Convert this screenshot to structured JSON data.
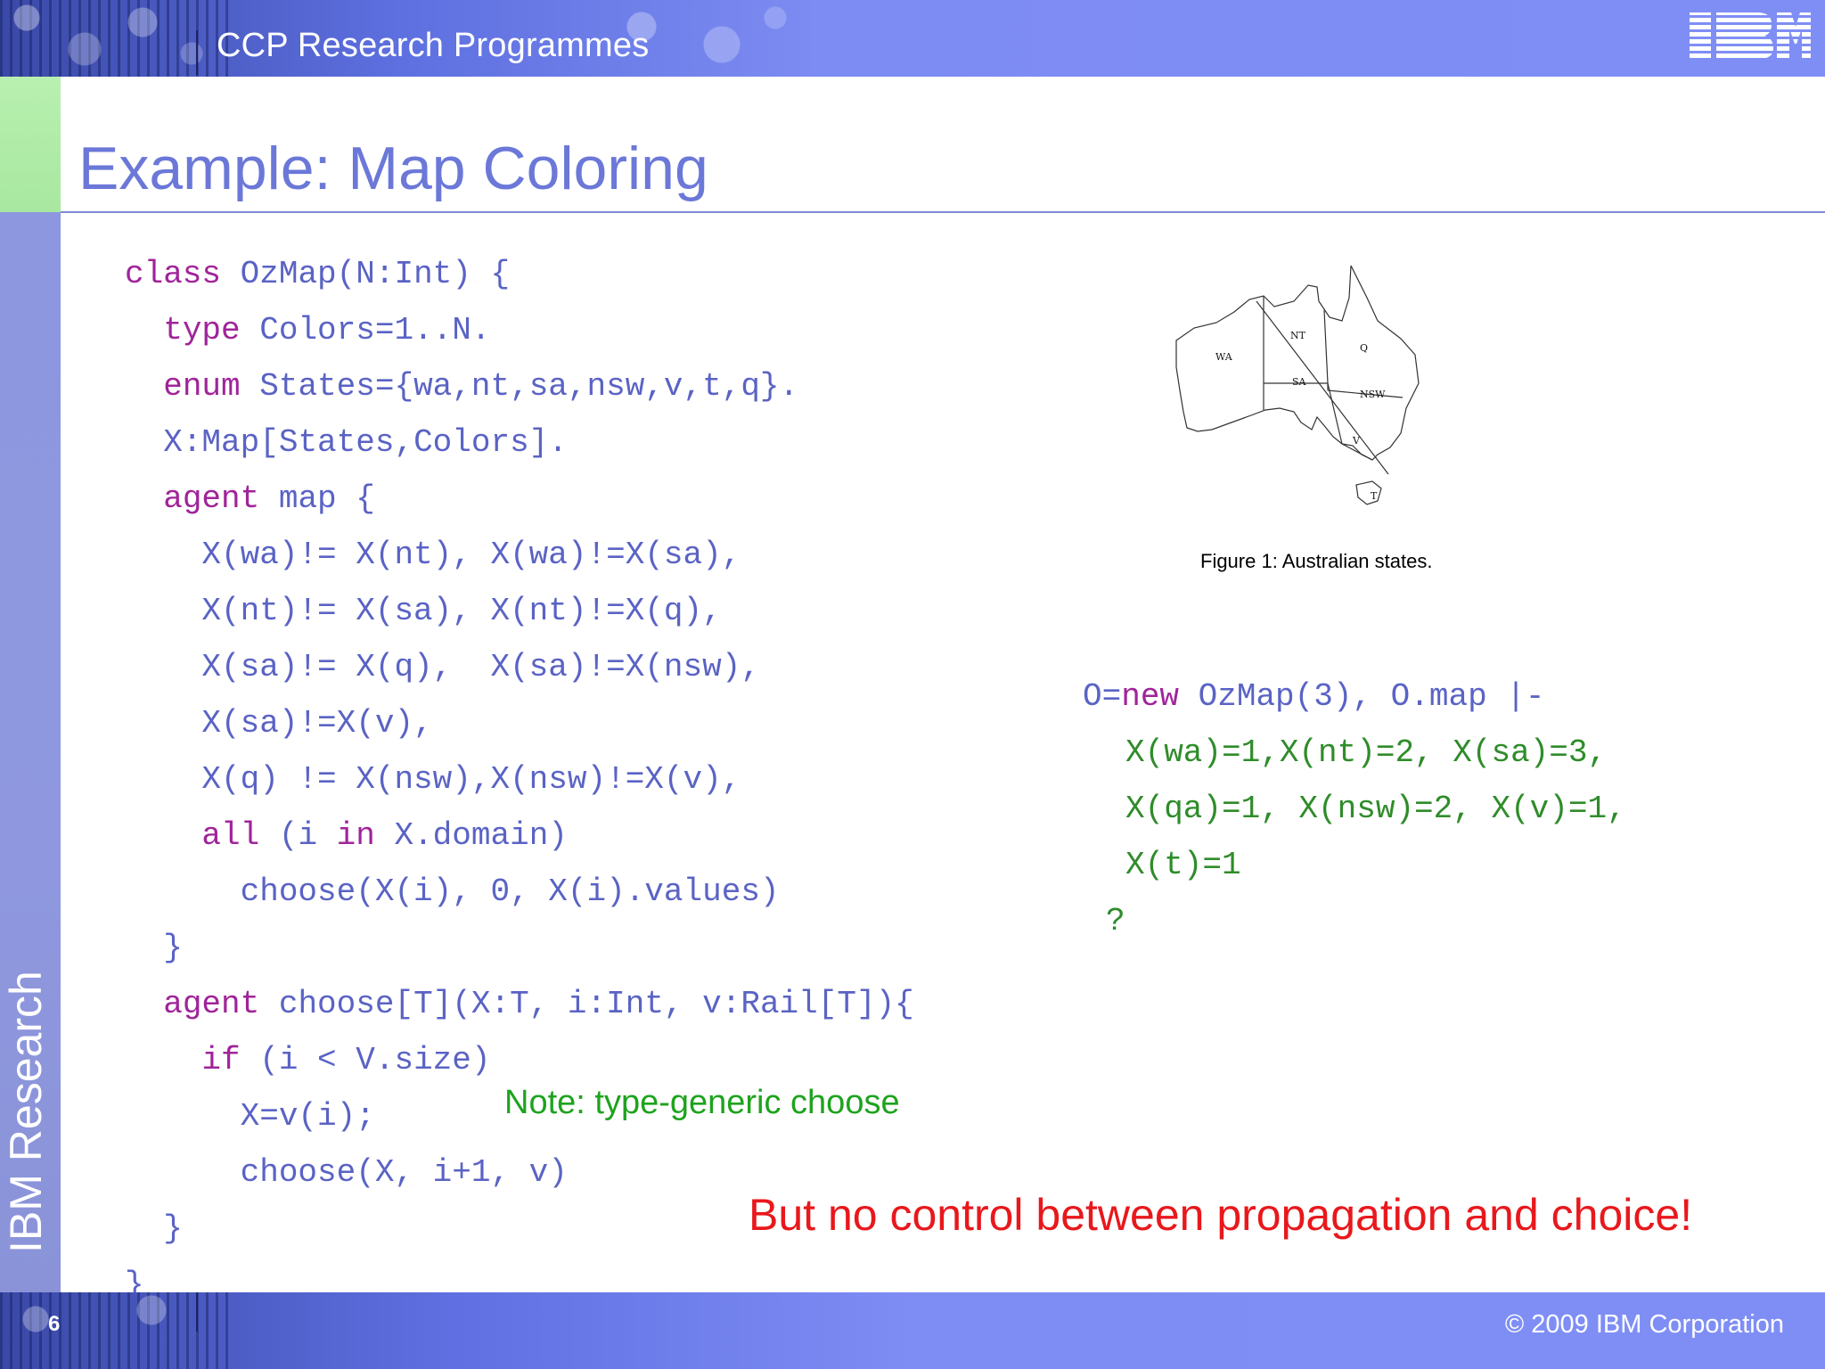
{
  "header": {
    "title": "CCP Research Programmes",
    "logo_text": "IBM"
  },
  "sidebar": {
    "label": "IBM Research"
  },
  "slide": {
    "title": "Example: Map Coloring"
  },
  "code": {
    "lines": [
      {
        "indent": "",
        "kw": "class",
        "rest": " OzMap(N:Int) {"
      },
      {
        "indent": "  ",
        "kw": "type",
        "rest": " Colors=1..N."
      },
      {
        "indent": "  ",
        "kw": "enum",
        "rest": " States={wa,nt,sa,nsw,v,t,q}."
      },
      {
        "indent": "  ",
        "kw": "",
        "rest": "X:Map[States,Colors]."
      },
      {
        "indent": "  ",
        "kw": "agent",
        "rest": " map {"
      },
      {
        "indent": "    ",
        "kw": "",
        "rest": "X(wa)!= X(nt), X(wa)!=X(sa),"
      },
      {
        "indent": "    ",
        "kw": "",
        "rest": "X(nt)!= X(sa), X(nt)!=X(q),"
      },
      {
        "indent": "    ",
        "kw": "",
        "rest": "X(sa)!= X(q),  X(sa)!=X(nsw),"
      },
      {
        "indent": "    ",
        "kw": "",
        "rest": "X(sa)!=X(v),"
      },
      {
        "indent": "    ",
        "kw": "",
        "rest": "X(q) != X(nsw),X(nsw)!=X(v),"
      },
      {
        "indent": "    ",
        "kw": "all",
        "rest": " (i ",
        "kw2": "in",
        "rest2": " X.domain)"
      },
      {
        "indent": "      ",
        "kw": "",
        "rest": "choose(X(i), 0, X(i).values)"
      },
      {
        "indent": "  ",
        "kw": "",
        "rest": "}"
      },
      {
        "indent": "  ",
        "kw": "agent",
        "rest": " choose[T](X:T, i:Int, v:Rail[T]){"
      },
      {
        "indent": "    ",
        "kw": "if",
        "rest": " (i < V.size)"
      },
      {
        "indent": "      ",
        "kw": "",
        "rest": "X=v(i);"
      },
      {
        "indent": "      ",
        "kw": "",
        "rest": "choose(X, i+1, v)"
      },
      {
        "indent": "  ",
        "kw": "",
        "rest": "}"
      },
      {
        "indent": "",
        "kw": "",
        "rest": "}"
      }
    ]
  },
  "figure": {
    "caption": "Figure 1:  Australian states.",
    "labels": {
      "wa": "WA",
      "nt": "NT",
      "q": "Q",
      "sa": "SA",
      "nsw": "NSW",
      "v": "V",
      "t": "T"
    }
  },
  "run": {
    "line1_a": "O=",
    "line1_kw": "new",
    "line1_b": " OzMap(3), O.map |-",
    "line2": "X(wa)=1,X(nt)=2, X(sa)=3,",
    "line3": "X(qa)=1, X(nsw)=2, X(v)=1,",
    "line4": "X(t)=1",
    "line5": "?"
  },
  "note": "Note: type-generic choose",
  "warning": "But no control between propagation and choice!",
  "footer": {
    "page_number": "6",
    "copyright": "© 2009 IBM Corporation"
  }
}
